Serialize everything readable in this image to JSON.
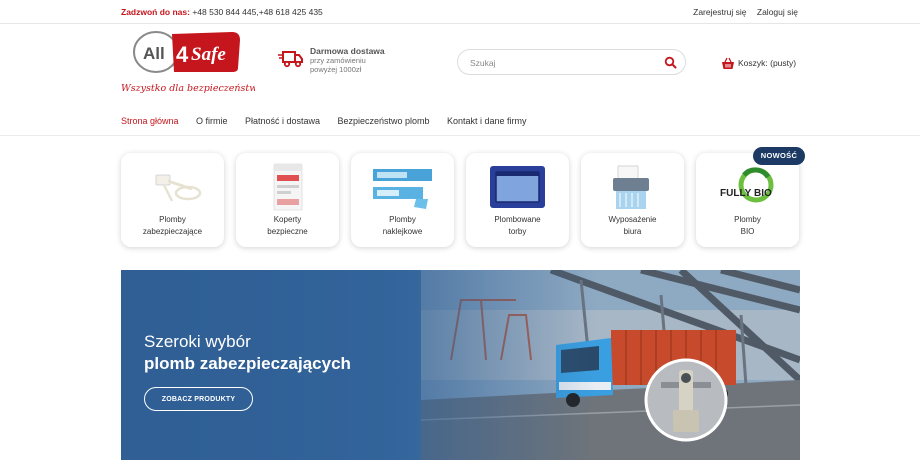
{
  "topbar": {
    "call_label": "Zadzwoń do nas:",
    "phones": " +48 530 844 445,+48 618 425 435",
    "register": "Zarejestruj się",
    "login": "Zaloguj się"
  },
  "logo": {
    "text_left": "All",
    "text_number": "4",
    "text_right": "Safe",
    "tagline": "Wszystko dla bezpieczeństwa"
  },
  "shipping": {
    "title": "Darmowa dostawa",
    "subtitle": "przy zamówieniu powyżej 1000zł"
  },
  "search": {
    "placeholder": "Szukaj",
    "value": ""
  },
  "cart": {
    "label": "Koszyk: (pusty)"
  },
  "nav": {
    "items": [
      {
        "label": "Strona główna"
      },
      {
        "label": "O firmie"
      },
      {
        "label": "Płatność i dostawa"
      },
      {
        "label": "Bezpieczeństwo plomb"
      },
      {
        "label": "Kontakt i dane firmy"
      }
    ]
  },
  "categories": {
    "badge": "NOWOŚĆ",
    "items": [
      {
        "label": "Plomby\nzabezpieczające"
      },
      {
        "label": "Koperty\nbezpieczne"
      },
      {
        "label": "Plomby\nnaklejkowe"
      },
      {
        "label": "Plombowane\ntorby"
      },
      {
        "label": "Wyposażenie\nbiura"
      },
      {
        "label": "Plomby\nBIO",
        "logo_text_1": "FULLY",
        "logo_text_2": "BIO"
      }
    ]
  },
  "banner": {
    "line1": "Szeroki wybór",
    "line2": "plomb zabezpieczających",
    "cta": "ZOBACZ PRODUKTY"
  },
  "colors": {
    "brand_red": "#c4161c",
    "badge_navy": "#1c3a64",
    "banner_blue": "#2f5f95"
  }
}
